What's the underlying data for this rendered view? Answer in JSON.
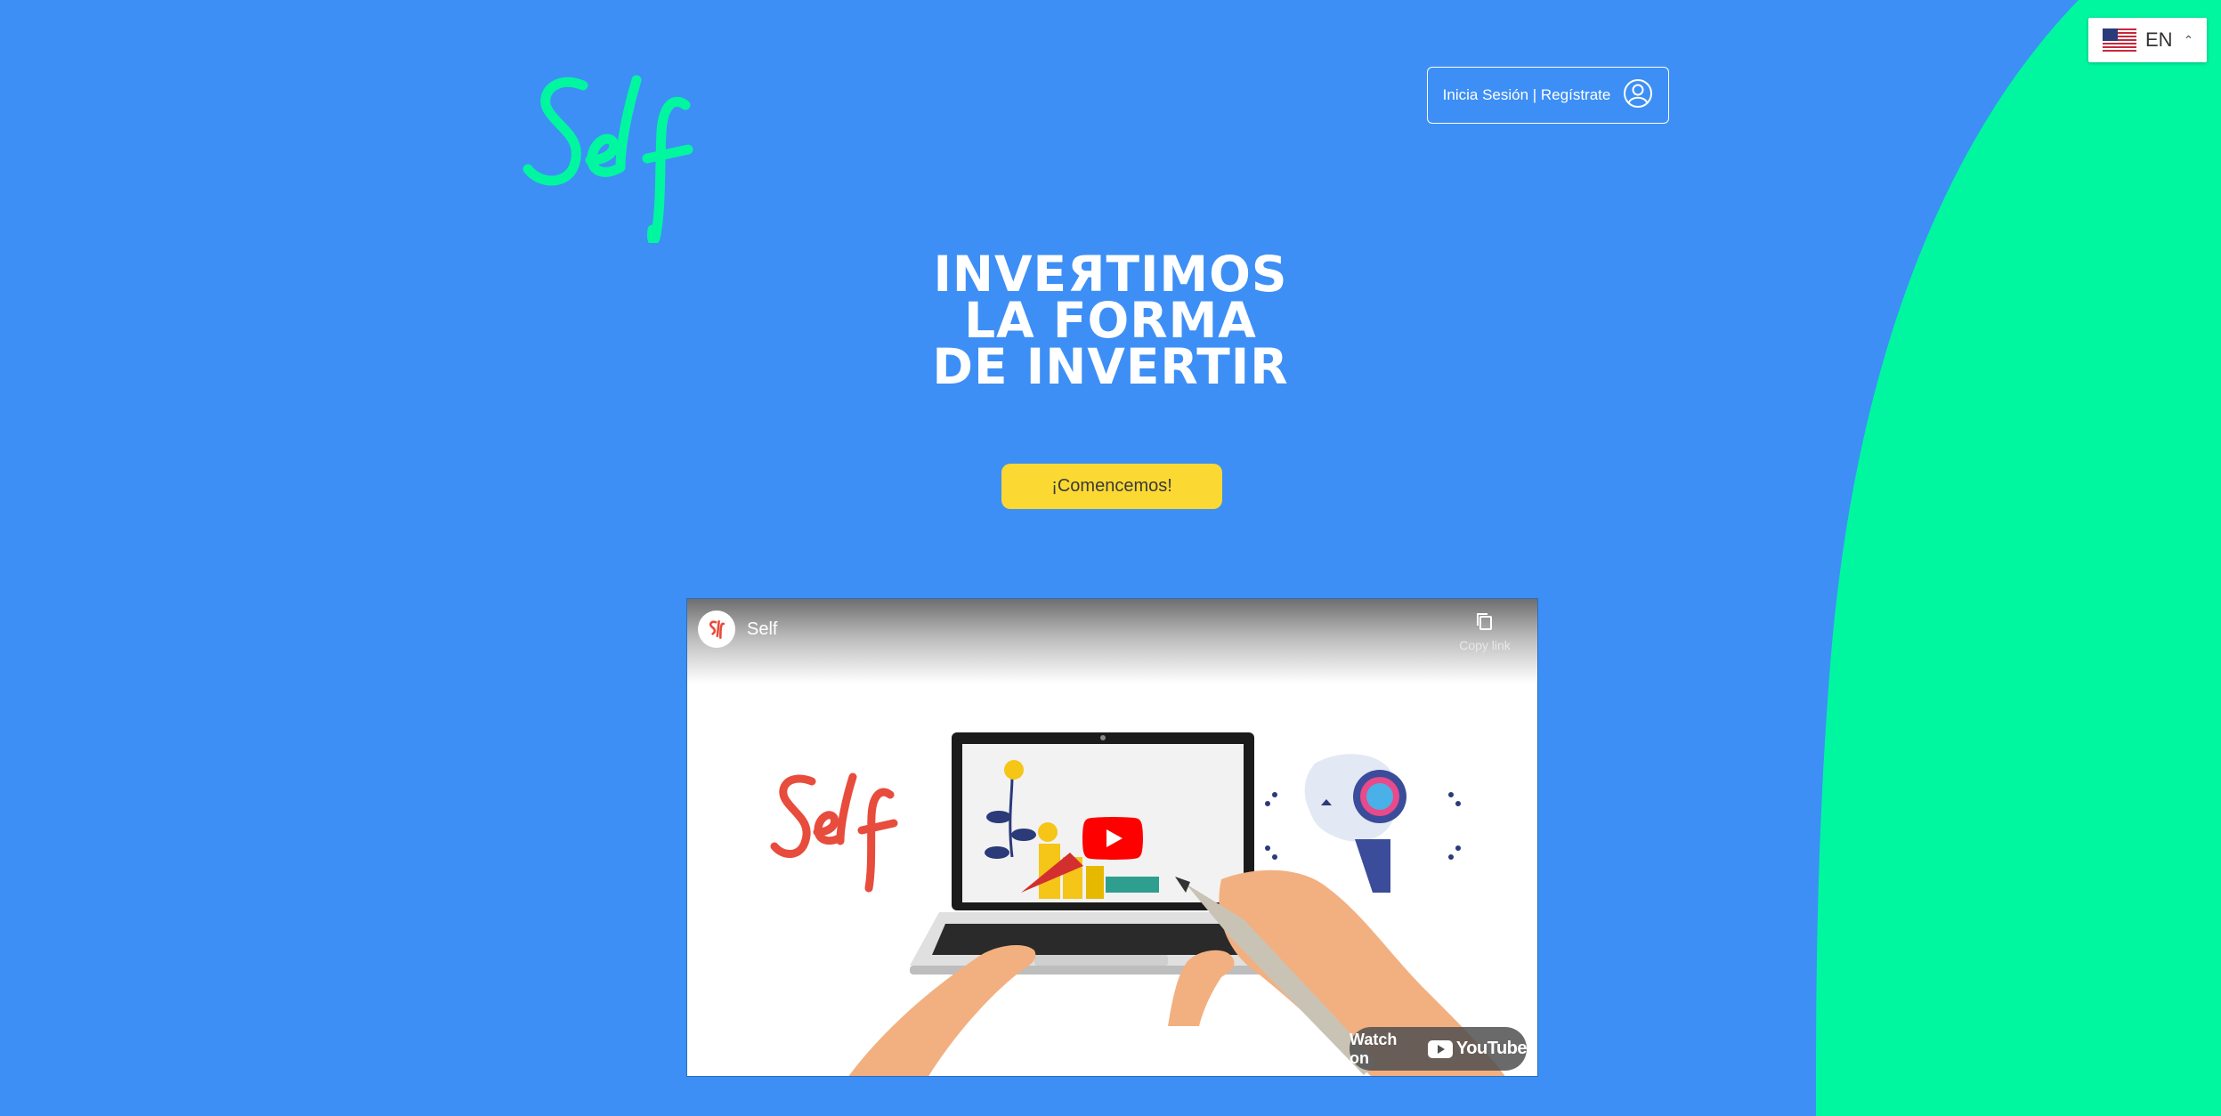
{
  "colors": {
    "background": "#3d8ff5",
    "accent_green": "#00f7a0",
    "cta_yellow": "#fbd932"
  },
  "header": {
    "logo_text": "Self",
    "auth_label": "Inicia Sesión | Regístrate",
    "auth_icon": "user-circle-icon"
  },
  "language": {
    "code": "EN",
    "flag_icon": "us-flag-icon",
    "caret_icon": "chevron-up-icon"
  },
  "hero": {
    "line1": "INVEЯTIMOS",
    "line2": "LA FORMA",
    "line3": "DE INVERTIR",
    "cta_label": "¡Comencemos!"
  },
  "video": {
    "channel_name": "Self",
    "copy_link_label": "Copy link",
    "watch_label": "Watch on",
    "youtube_label": "YouTube",
    "thumbnail_logo_text": "Self"
  }
}
